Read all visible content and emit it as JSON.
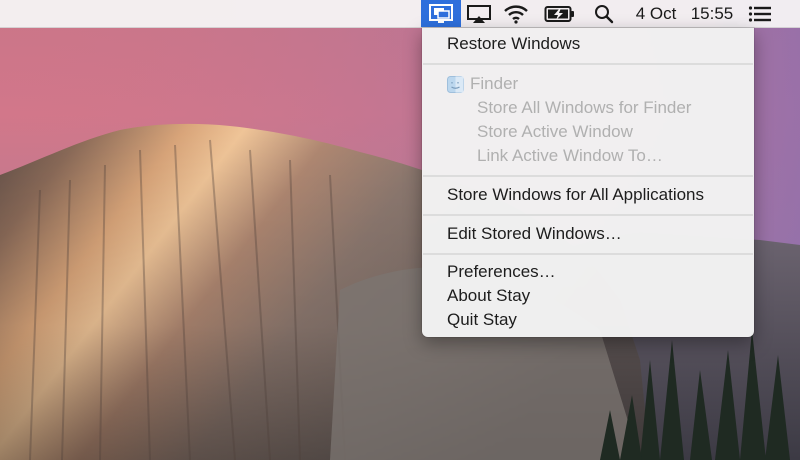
{
  "menubar": {
    "date": "4 Oct",
    "time": "15:55",
    "status_icons": [
      "stay-icon",
      "airplay-icon",
      "wifi-icon",
      "battery-charging-icon",
      "spotlight-search-icon",
      "notification-center-icon"
    ]
  },
  "menu": {
    "restore_windows": "Restore Windows",
    "app_name": "Finder",
    "store_all_for_app": "Store All Windows for Finder",
    "store_active": "Store Active Window",
    "link_active": "Link Active Window To…",
    "store_all_apps": "Store Windows for All Applications",
    "edit_stored": "Edit Stored Windows…",
    "preferences": "Preferences…",
    "about": "About Stay",
    "quit": "Quit Stay"
  },
  "colors": {
    "status_highlight": "#2e6fdc",
    "menu_background": "#f2f2f2",
    "disabled_text": "#b0b0b0"
  }
}
